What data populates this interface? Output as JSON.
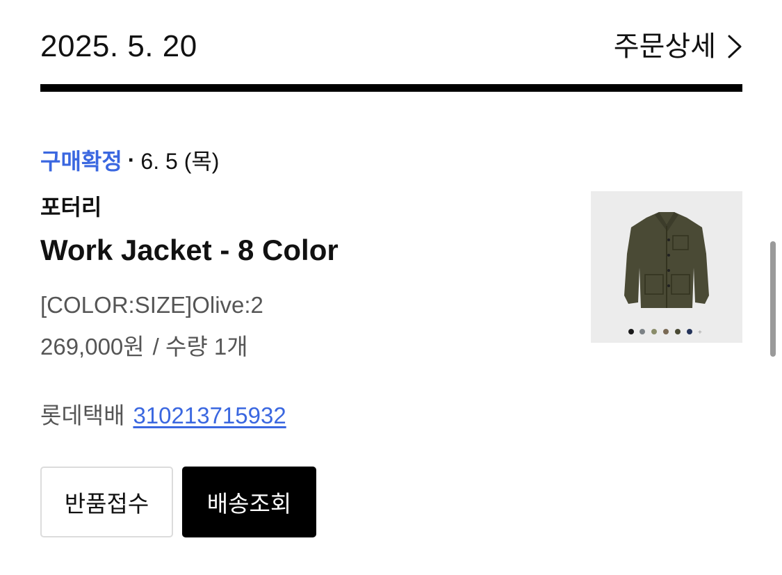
{
  "order": {
    "date": "2025. 5. 20",
    "detail_label": "주문상세"
  },
  "item": {
    "status": "구매확정",
    "separator": "·",
    "status_date": "6. 5 (목)",
    "brand": "포터리",
    "name": "Work Jacket - 8 Color",
    "option": "[COLOR:SIZE]Olive:2",
    "price": "269,000원",
    "quantity": "/ 수량 1개",
    "thumbnail_alt": "olive work jacket product image"
  },
  "shipping": {
    "carrier": "롯데택배",
    "tracking_number": "310213715932"
  },
  "actions": {
    "return_label": "반품접수",
    "track_label": "배송조회"
  },
  "colors": {
    "accent": "#3a67e0",
    "primary_button_bg": "#000000",
    "divider": "#000000",
    "secondary_text": "#555555"
  },
  "icons": {
    "detail_chevron": "chevron-right-icon"
  }
}
